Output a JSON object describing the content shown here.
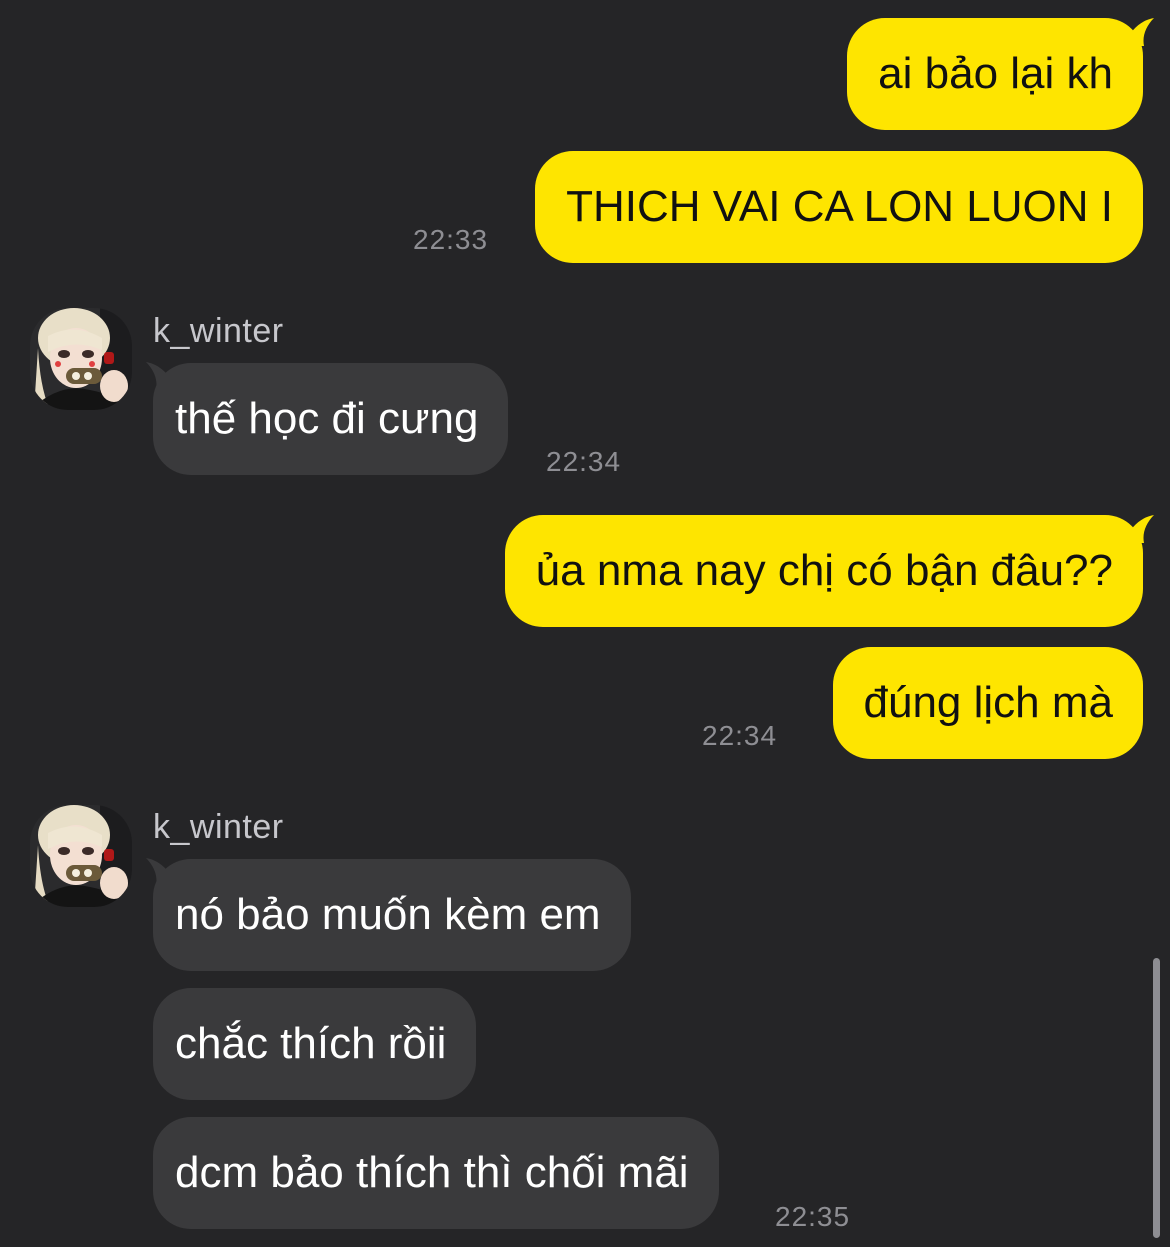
{
  "colors": {
    "background": "#252527",
    "my_bubble": "#fee500",
    "their_bubble": "#3a3a3c",
    "timestamp": "#8e8e93"
  },
  "messages": {
    "m1": {
      "text": "ai bảo lại kh"
    },
    "m2": {
      "text": "THICH VAI CA LON LUON I",
      "time": "22:33"
    },
    "group1": {
      "sender": "k_winter",
      "avatar_icon": "profile-photo",
      "m1": {
        "text": "thế học đi cưng",
        "time": "22:34"
      }
    },
    "m3": {
      "text": "ủa nma nay chị có bận đâu??"
    },
    "m4": {
      "text": "đúng lịch mà",
      "time": "22:34"
    },
    "group2": {
      "sender": "k_winter",
      "avatar_icon": "profile-photo",
      "m1": {
        "text": "nó bảo muốn kèm em"
      },
      "m2": {
        "text": "chắc thích rồii"
      },
      "m3": {
        "text": "dcm bảo thích thì chối mãi",
        "time": "22:35"
      }
    }
  }
}
